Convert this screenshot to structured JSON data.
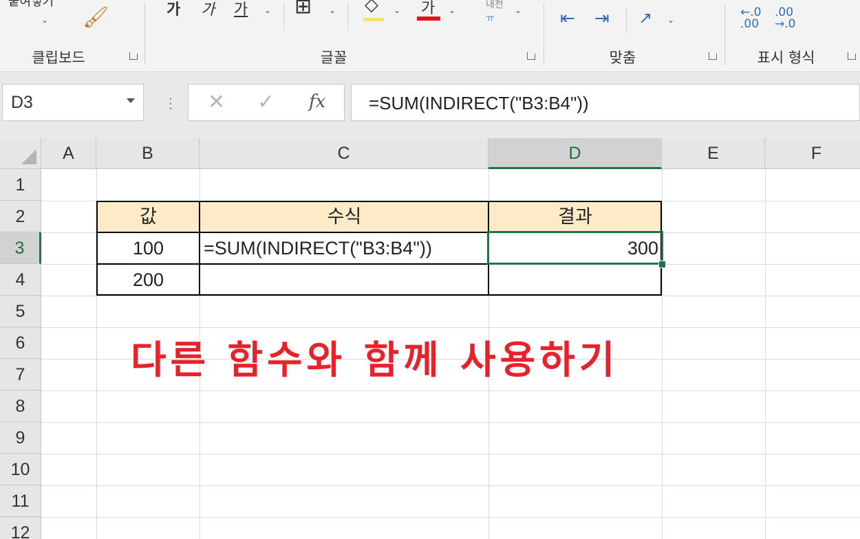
{
  "ribbon": {
    "groups": [
      {
        "label": "클립보드"
      },
      {
        "label": "글꼴"
      },
      {
        "label": "맞춤"
      },
      {
        "label": "표시 형식"
      }
    ],
    "font_buttons": [
      "가",
      "가",
      "가"
    ],
    "number_format_buttons": [
      ".00→.0",
      ".00→.0"
    ]
  },
  "formula_bar": {
    "name_box": "D3",
    "formula": "=SUM(INDIRECT(\"B3:B4\"))"
  },
  "sheet": {
    "columns": [
      "A",
      "B",
      "C",
      "D",
      "E",
      "F"
    ],
    "rows": [
      "1",
      "2",
      "3",
      "4",
      "5",
      "6",
      "7",
      "8",
      "9",
      "10",
      "11",
      "12"
    ],
    "table": {
      "headers": [
        "값",
        "수식",
        "결과"
      ],
      "row3": {
        "value": "100",
        "formula": "=SUM(INDIRECT(\"B3:B4\"))",
        "result": "300"
      },
      "row4": {
        "value": "200",
        "formula": "",
        "result": ""
      }
    },
    "title_text": "다른 함수와 함께 사용하기",
    "colors": {
      "accent": "#217346",
      "header_fill": "#fdebc8",
      "title": "#e8222a"
    }
  }
}
